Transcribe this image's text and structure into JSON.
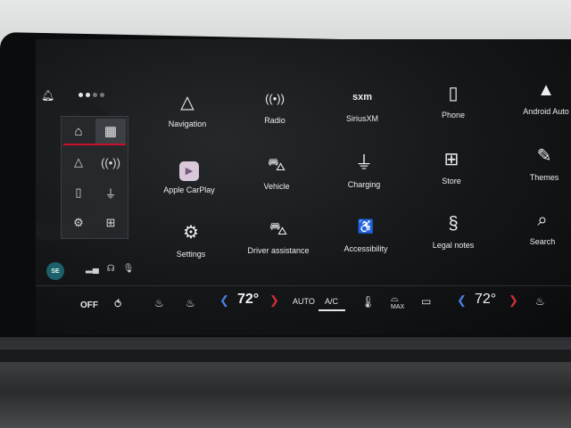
{
  "launcher": {
    "tabs": [
      {
        "name": "home",
        "icon": "⌂"
      },
      {
        "name": "all-apps",
        "icon": "▦"
      }
    ],
    "shortcuts": [
      "navigation-arrow-icon",
      "radio-icon",
      "phone-icon",
      "charging-plug-icon",
      "settings-gear-icon",
      "store-bag-icon"
    ]
  },
  "user": {
    "initials": "SE"
  },
  "apps": [
    {
      "name": "navigation",
      "label": "Navigation",
      "icon": "△"
    },
    {
      "name": "radio",
      "label": "Radio",
      "icon": "((•))"
    },
    {
      "name": "siriusxm",
      "label": "SiriusXM",
      "icon": "sxm"
    },
    {
      "name": "phone",
      "label": "Phone",
      "icon": "▯"
    },
    {
      "name": "android-auto",
      "label": "Android Auto",
      "icon": "▲"
    },
    {
      "name": "apple-carplay",
      "label": "Apple CarPlay",
      "icon": "▶"
    },
    {
      "name": "vehicle",
      "label": "Vehicle",
      "icon": "⛍"
    },
    {
      "name": "charging",
      "label": "Charging",
      "icon": "⏚"
    },
    {
      "name": "store",
      "label": "Store",
      "icon": "⊞"
    },
    {
      "name": "themes",
      "label": "Themes",
      "icon": "✎"
    },
    {
      "name": "settings",
      "label": "Settings",
      "icon": "⚙"
    },
    {
      "name": "driver-assistance",
      "label": "Driver assistance",
      "icon": "⛍"
    },
    {
      "name": "accessibility",
      "label": "Accessibility",
      "icon": "♿"
    },
    {
      "name": "legal-notes",
      "label": "Legal notes",
      "icon": "§"
    },
    {
      "name": "search",
      "label": "Search",
      "icon": "⌕"
    }
  ],
  "climate": {
    "off_label": "OFF",
    "left_temp": "72°",
    "auto_label": "AUTO",
    "ac_label": "A/C",
    "max_label": "MAX",
    "right_temp": "72°"
  },
  "colors": {
    "accent_red": "#c8102e",
    "android_blue": "#3a7be0",
    "temp_left_arrow": "#4a7fe0",
    "temp_right_arrow": "#d03030"
  }
}
